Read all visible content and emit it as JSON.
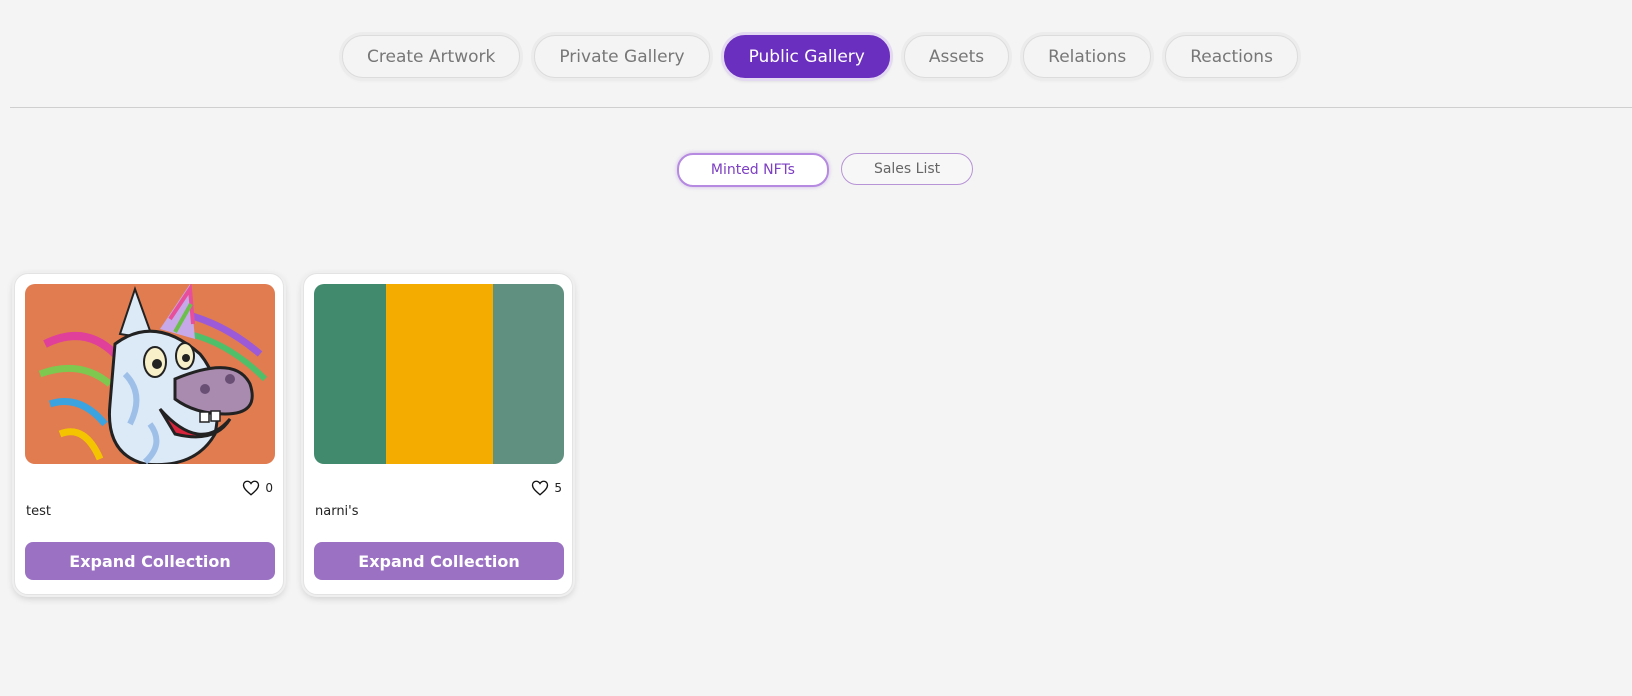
{
  "top_nav": {
    "items": [
      {
        "label": "Create Artwork",
        "active": false
      },
      {
        "label": "Private Gallery",
        "active": false
      },
      {
        "label": "Public Gallery",
        "active": true
      },
      {
        "label": "Assets",
        "active": false
      },
      {
        "label": "Relations",
        "active": false
      },
      {
        "label": "Reactions",
        "active": false
      }
    ]
  },
  "sub_nav": {
    "items": [
      {
        "label": "Minted NFTs",
        "active": true
      },
      {
        "label": "Sales List",
        "active": false
      }
    ]
  },
  "cards": [
    {
      "image": "unicorn-cartoon-artwork",
      "likes": "0",
      "title": "test",
      "button_label": "Expand Collection"
    },
    {
      "image": "vertical-color-stripes",
      "likes": "5",
      "title": "narni's",
      "button_label": "Expand Collection"
    }
  ],
  "colors": {
    "accent": "#6b2fbf",
    "button": "#9b72c3",
    "background": "#f4f4f4",
    "stripe_left": "#418a6e",
    "stripe_middle": "#f5ac00",
    "stripe_right": "#5f9080",
    "unicorn_background": "#f07845"
  }
}
